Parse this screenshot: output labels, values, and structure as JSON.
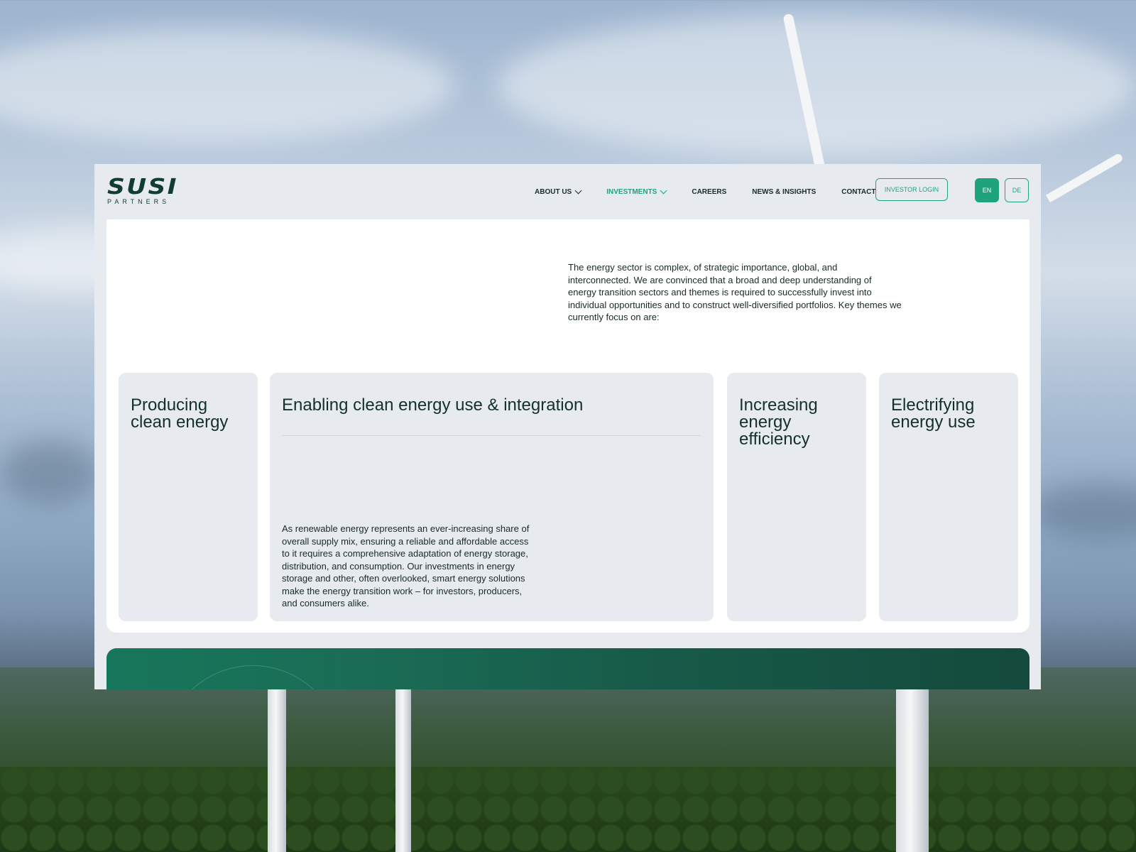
{
  "brand": {
    "logo_mark": "SUSI",
    "logo_sub": "PARTNERS"
  },
  "nav": {
    "items": [
      {
        "label": "ABOUT US",
        "dropdown": true,
        "active": false
      },
      {
        "label": "INVESTMENTS",
        "dropdown": true,
        "active": true
      },
      {
        "label": "CAREERS",
        "dropdown": false,
        "active": false
      },
      {
        "label": "NEWS & INSIGHTS",
        "dropdown": false,
        "active": false
      },
      {
        "label": "CONTACT",
        "dropdown": false,
        "active": false
      }
    ],
    "login_label": "INVESTOR LOGIN",
    "languages": [
      "EN",
      "DE"
    ],
    "selected_language": "EN"
  },
  "intro_text": "The energy sector is complex, of strategic importance, global, and interconnected. We are convinced that a broad and deep understanding of energy transition sectors and themes is required to successfully invest into individual opportunities and to construct well-diversified portfolios. Key themes we currently focus on are:",
  "themes": [
    {
      "title": "Producing clean energy"
    },
    {
      "title": "Enabling clean energy use & integration",
      "body": "As renewable energy represents an ever-increasing share of overall supply mix, ensuring a reliable and affordable access to it requires a comprehensive adaptation of energy storage, distribution, and consumption. Our investments in energy storage and other, often overlooked, smart energy solutions make the energy transition work – for investors, producers, and consumers alike."
    },
    {
      "title": "Increasing energy efficiency"
    },
    {
      "title": "Electrifying energy use"
    }
  ],
  "colors": {
    "accent": "#1fa37c",
    "dark_green": "#0f3d33",
    "card_bg": "#e7ebef",
    "frame_bg": "#e7ebef"
  }
}
